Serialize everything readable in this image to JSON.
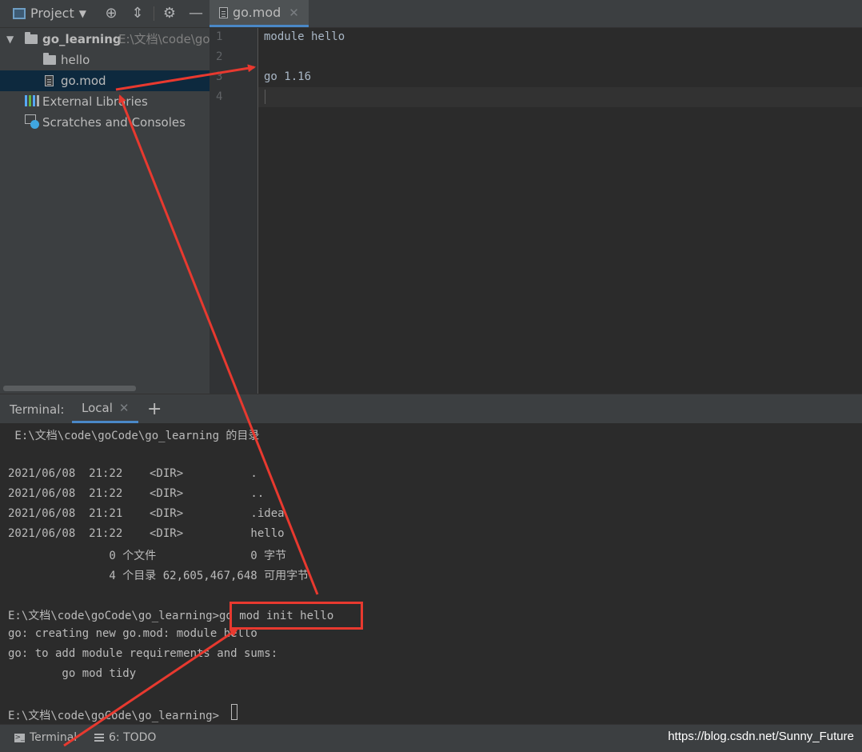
{
  "project_panel": {
    "title": "Project",
    "toolbar_icons": [
      "chevron-down-icon",
      "locate-icon",
      "collapse-icon",
      "gear-icon",
      "minimize-icon"
    ],
    "tree": {
      "root_name": "go_learning",
      "root_path": "E:\\文档\\code\\go",
      "items": [
        {
          "label": "hello",
          "icon": "folder-icon"
        },
        {
          "label": "go.mod",
          "icon": "file-icon",
          "selected": true
        },
        {
          "label": "External Libraries",
          "icon": "library-icon"
        },
        {
          "label": "Scratches and Consoles",
          "icon": "scratch-icon"
        }
      ]
    }
  },
  "editor": {
    "tab_label": "go.mod",
    "line_numbers": [
      "1",
      "2",
      "3",
      "4"
    ],
    "lines": [
      "module hello",
      "",
      "go 1.16",
      ""
    ]
  },
  "terminal": {
    "header_label": "Terminal:",
    "tab_label": "Local",
    "lines": [
      " E:\\文档\\code\\goCode\\go_learning 的目录",
      "",
      "2021/06/08  21:22    <DIR>          .",
      "2021/06/08  21:22    <DIR>          ..",
      "2021/06/08  21:21    <DIR>          .idea",
      "2021/06/08  21:22    <DIR>          hello",
      "               0 个文件              0 字节",
      "               4 个目录 62,605,467,648 可用字节",
      "",
      "E:\\文档\\code\\goCode\\go_learning>go mod init hello",
      "go: creating new go.mod: module hello",
      "go: to add module requirements and sums:",
      "        go mod tidy",
      "",
      "E:\\文档\\code\\goCode\\go_learning>"
    ]
  },
  "status_bar": {
    "terminal_label": "Terminal",
    "todo_label": "6: TODO"
  },
  "watermark": "https://blog.csdn.net/Sunny_Future",
  "colors": {
    "annotation": "#e8392f",
    "selection": "#0d293e",
    "accent": "#4a88c7"
  }
}
